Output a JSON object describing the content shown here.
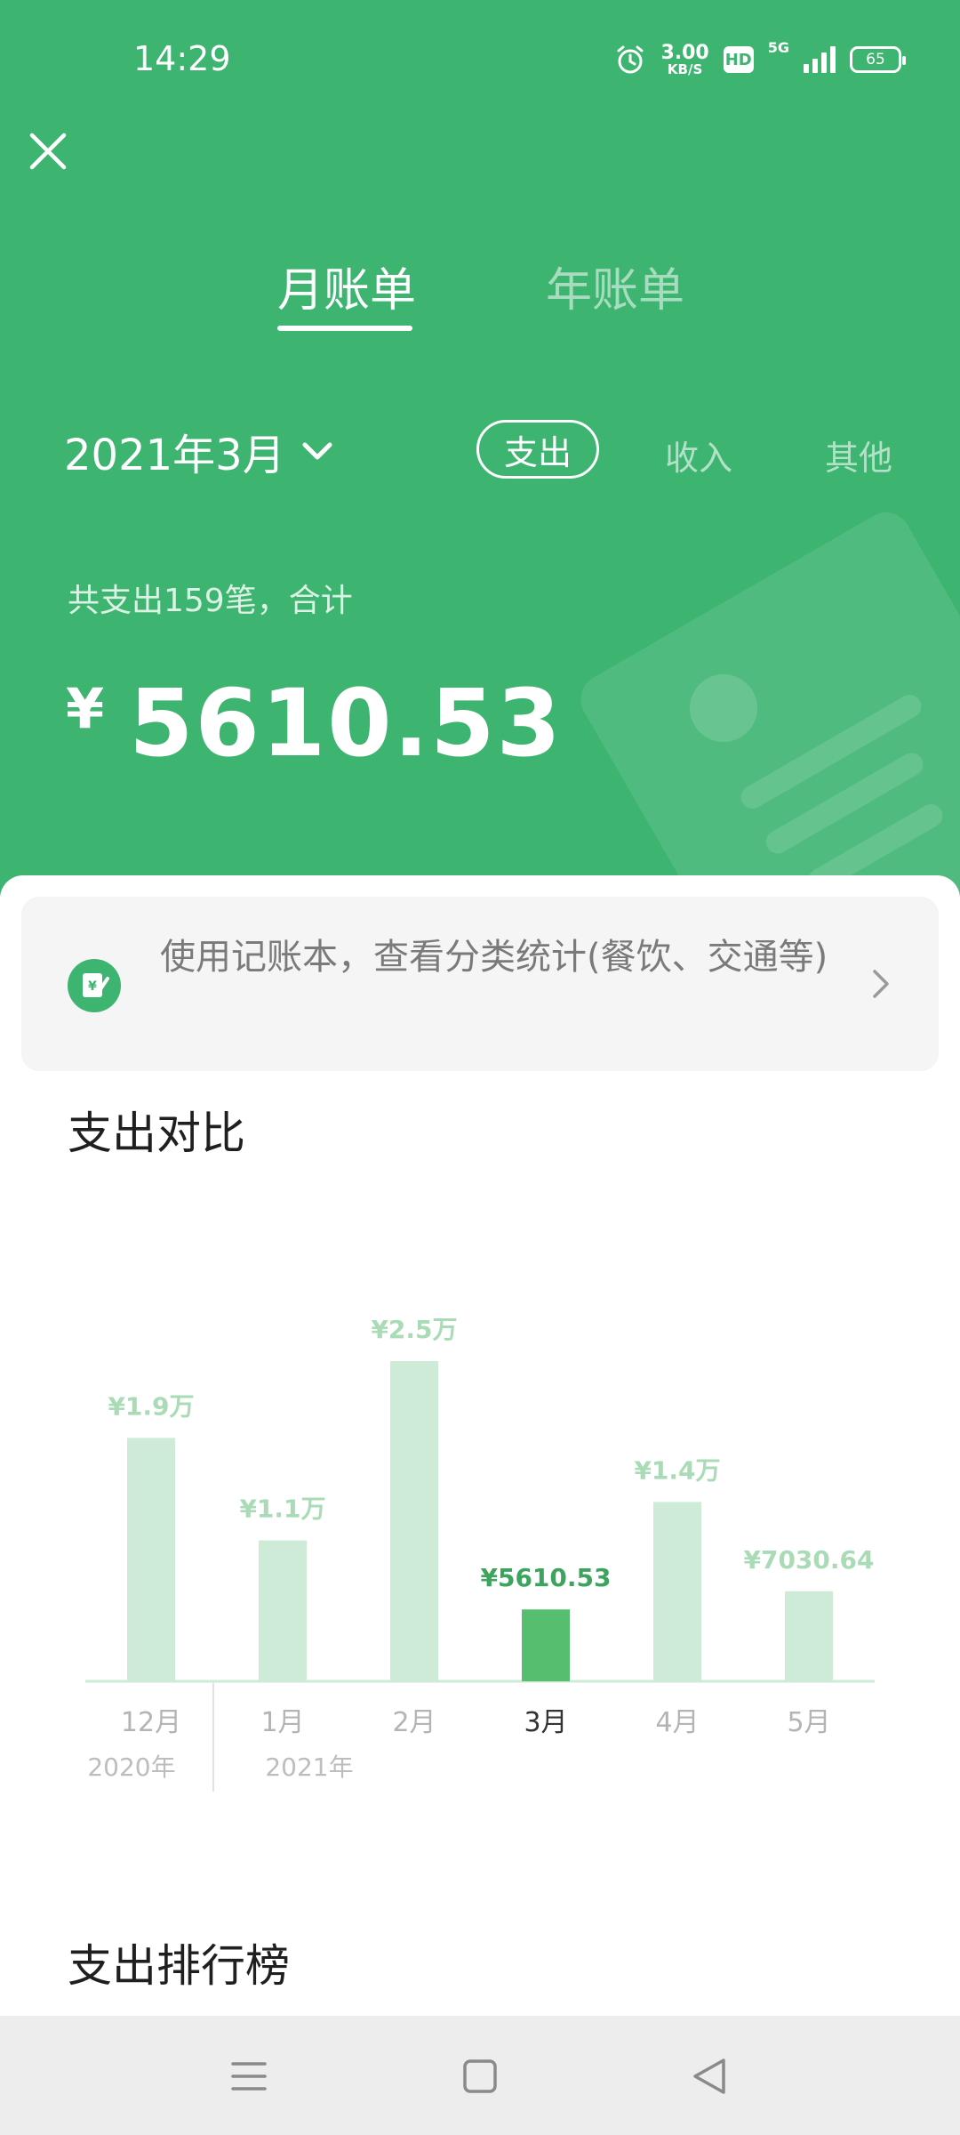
{
  "status_bar": {
    "time": "14:29",
    "speed_value": "3.00",
    "speed_unit": "KB/S",
    "hd": "HD",
    "network": "5G",
    "battery": "65"
  },
  "tabs": [
    {
      "label": "月账单",
      "active": true
    },
    {
      "label": "年账单",
      "active": false
    }
  ],
  "period": {
    "label": "2021年3月"
  },
  "filters": [
    {
      "label": "支出",
      "active": true
    },
    {
      "label": "收入",
      "active": false
    },
    {
      "label": "其他",
      "active": false
    }
  ],
  "summary": {
    "text": "共支出159笔，合计",
    "currency": "¥",
    "total": "5610.53"
  },
  "promo": {
    "text": "使用记账本，查看分类统计(餐饮、交通等)"
  },
  "sections": {
    "comparison_title": "支出对比",
    "ranking_title": "支出排行榜"
  },
  "colors": {
    "header_green": "#3db470",
    "bar_active": "#55bf6f",
    "bar_inactive": "#cdebd6",
    "label_active": "#3da45d",
    "label_inactive": "#a9dcb6"
  },
  "chart_data": {
    "type": "bar",
    "categories": [
      "12月",
      "1月",
      "2月",
      "3月",
      "4月",
      "5月"
    ],
    "year_labels": [
      "2020年",
      "2021年"
    ],
    "values": [
      19000,
      11000,
      25000,
      5610.53,
      14000,
      7030.64
    ],
    "value_labels": [
      "¥1.9万",
      "¥1.1万",
      "¥2.5万",
      "¥5610.53",
      "¥1.4万",
      "¥7030.64"
    ],
    "highlight_index": 3,
    "ylim": [
      0,
      25000
    ]
  }
}
